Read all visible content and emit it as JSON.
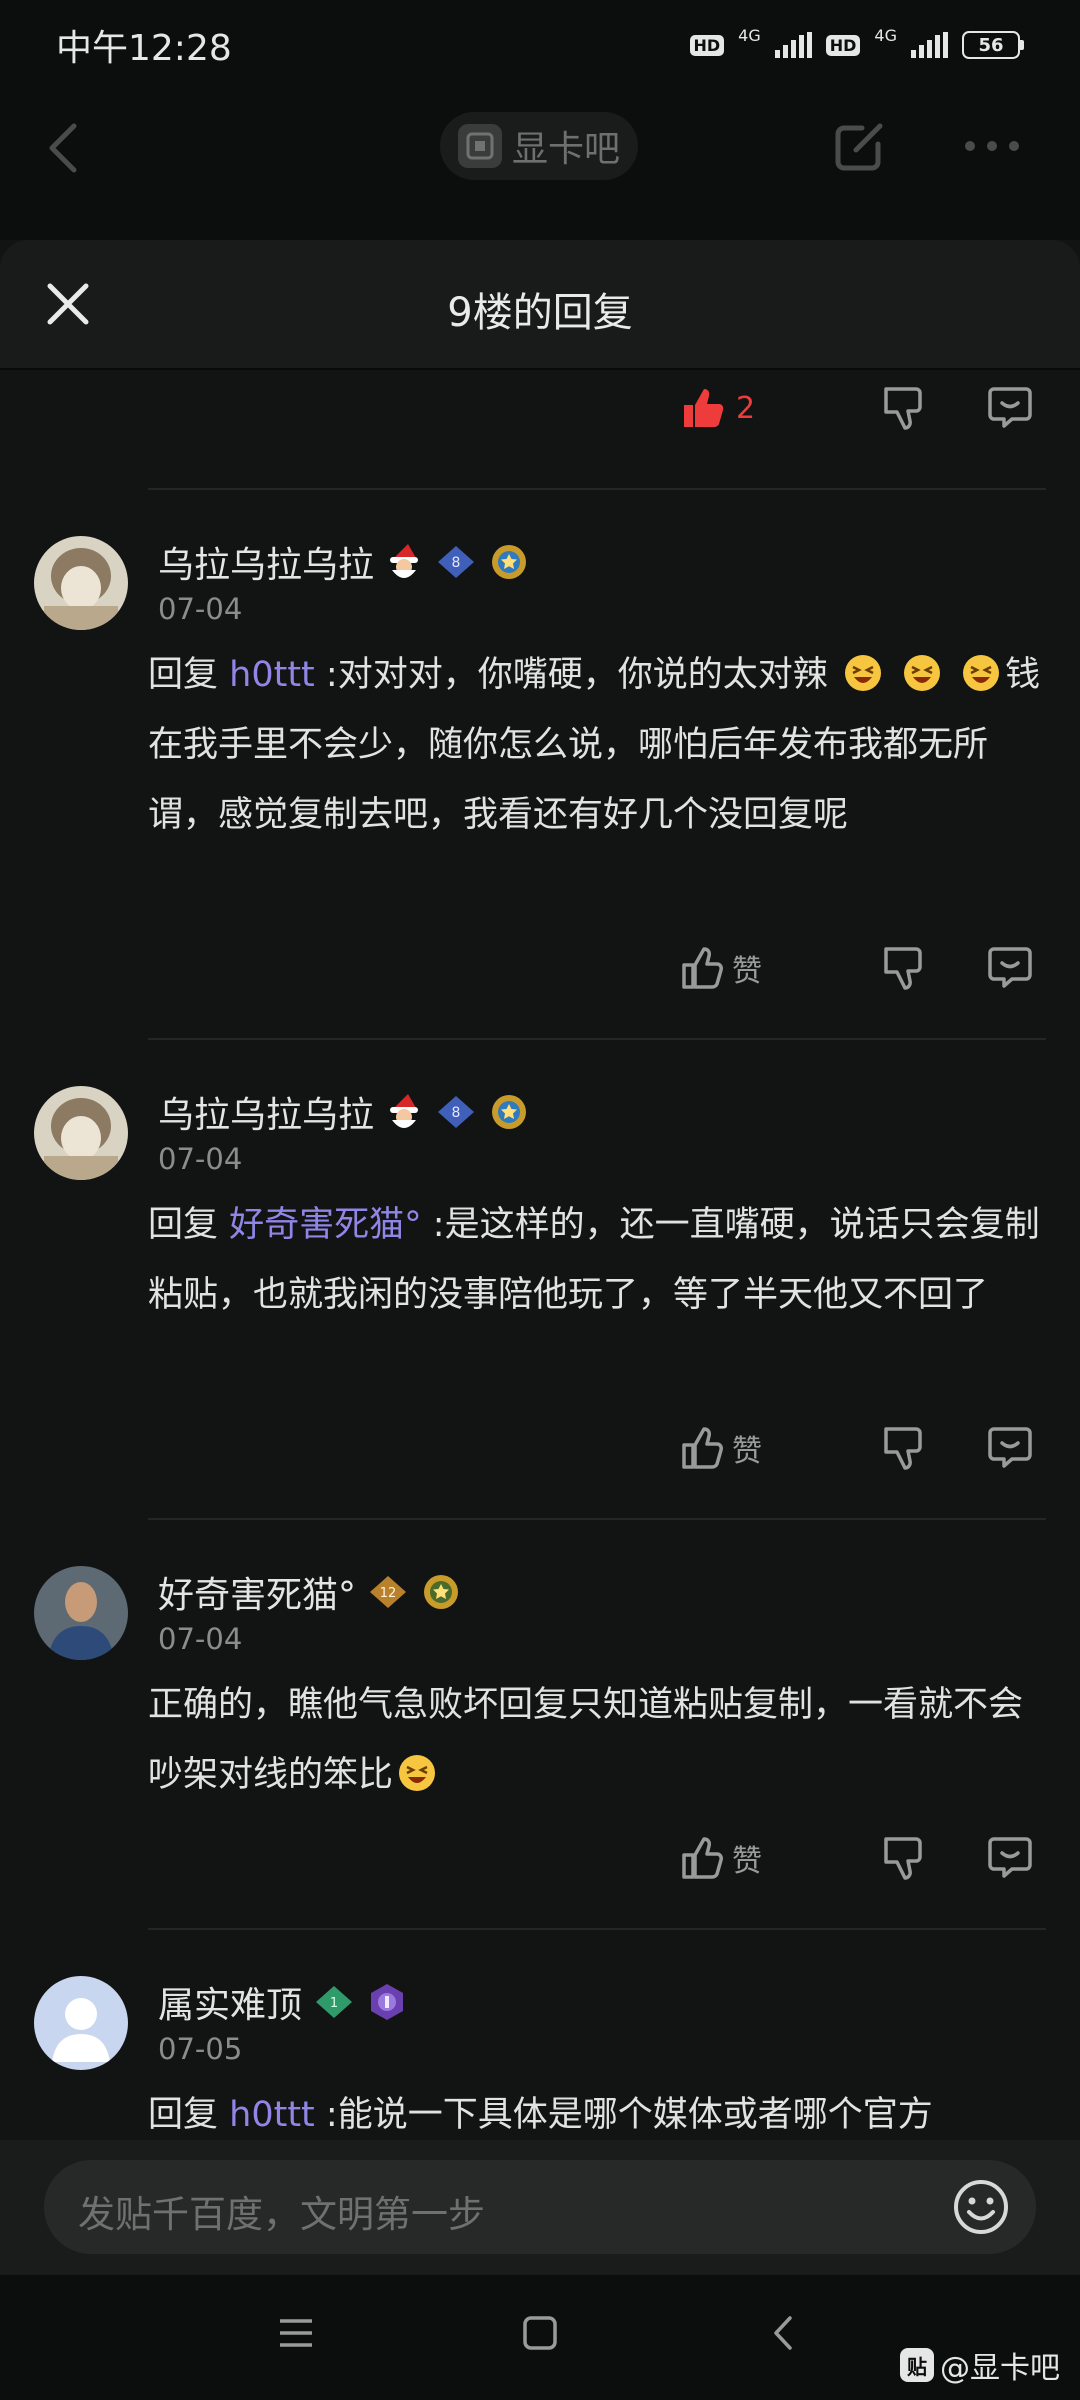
{
  "status_bar": {
    "time": "中午12:28",
    "hd1": "HD",
    "net1": "4G",
    "hd2": "HD",
    "net2": "4G",
    "battery": "56"
  },
  "top_nav": {
    "forum_name": "显卡吧",
    "icons": [
      "back-icon",
      "share-icon",
      "more-icon"
    ]
  },
  "sheet": {
    "title": "9楼的回复"
  },
  "top_actions": {
    "like_count": "2",
    "like_active": true,
    "like_color": "#ee3b3b"
  },
  "comments": [
    {
      "username": "乌拉乌拉乌拉",
      "level": "8",
      "date": "07-04",
      "reply_prefix": "回复",
      "mention": "h0ttt",
      "text_a": " :对对对，你嘴硬，你说的太对辣",
      "text_b": "钱在我手里不会少，随你怎么说，哪怕后年发布我都无所谓，感觉复制去吧，我看还有好几个没回复呢",
      "like_label": "赞"
    },
    {
      "username": "乌拉乌拉乌拉",
      "level": "8",
      "date": "07-04",
      "reply_prefix": "回复",
      "mention": "好奇害死猫°",
      "text_a": " :是这样的，还一直嘴硬，说话只会复制粘贴，也就我闲的没事陪他玩了，等了半天他又不回了",
      "like_label": "赞"
    },
    {
      "username": "好奇害死猫°",
      "level": "12",
      "date": "07-04",
      "text_a": "正确的，瞧他气急败坏回复只知道粘贴复制，一看就不会吵架对线的笨比",
      "like_label": "赞"
    },
    {
      "username": "属实难顶",
      "level": "1",
      "date": "07-05",
      "reply_prefix": "回复",
      "mention": "h0ttt",
      "text_a": " :能说一下具体是哪个媒体或者哪个官方"
    }
  ],
  "input": {
    "placeholder": "发贴千百度，文明第一步"
  },
  "watermark": {
    "logo_text": "贴",
    "text": "@显卡吧"
  },
  "colors": {
    "accent_mention": "#8f86e6",
    "like_active": "#ee3b3b",
    "background": "#121414"
  }
}
